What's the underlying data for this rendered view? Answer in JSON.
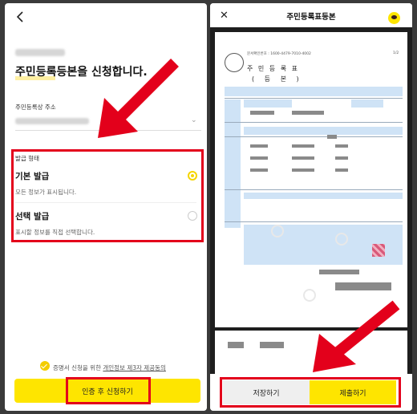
{
  "left": {
    "title": "주민등록등본을 신청합니다.",
    "address_label": "주민등록상 주소",
    "issue_type_label": "발급 형태",
    "options": [
      {
        "title": "기본 발급",
        "desc": "모든 정보가 표시됩니다.",
        "selected": true
      },
      {
        "title": "선택 발급",
        "desc": "표시할 정보를 직접 선택합니다.",
        "selected": false
      }
    ],
    "consent_prefix": "증명서 신청을 위한 ",
    "consent_link": "개인정보 제3자 제공동의",
    "apply_button": "인증 후 신청하기"
  },
  "right": {
    "header_title": "주민등록표등본",
    "doc_title": "주 민 등 록 표",
    "doc_subtitle": "( 등    본 )",
    "doc_ref": "문서확인번호 : 1600-4479-7010-4002",
    "page_num": "1/2",
    "save_button": "저장하기",
    "submit_button": "제출하기"
  },
  "colors": {
    "accent": "#fee500",
    "highlight_red": "#e3001b"
  }
}
